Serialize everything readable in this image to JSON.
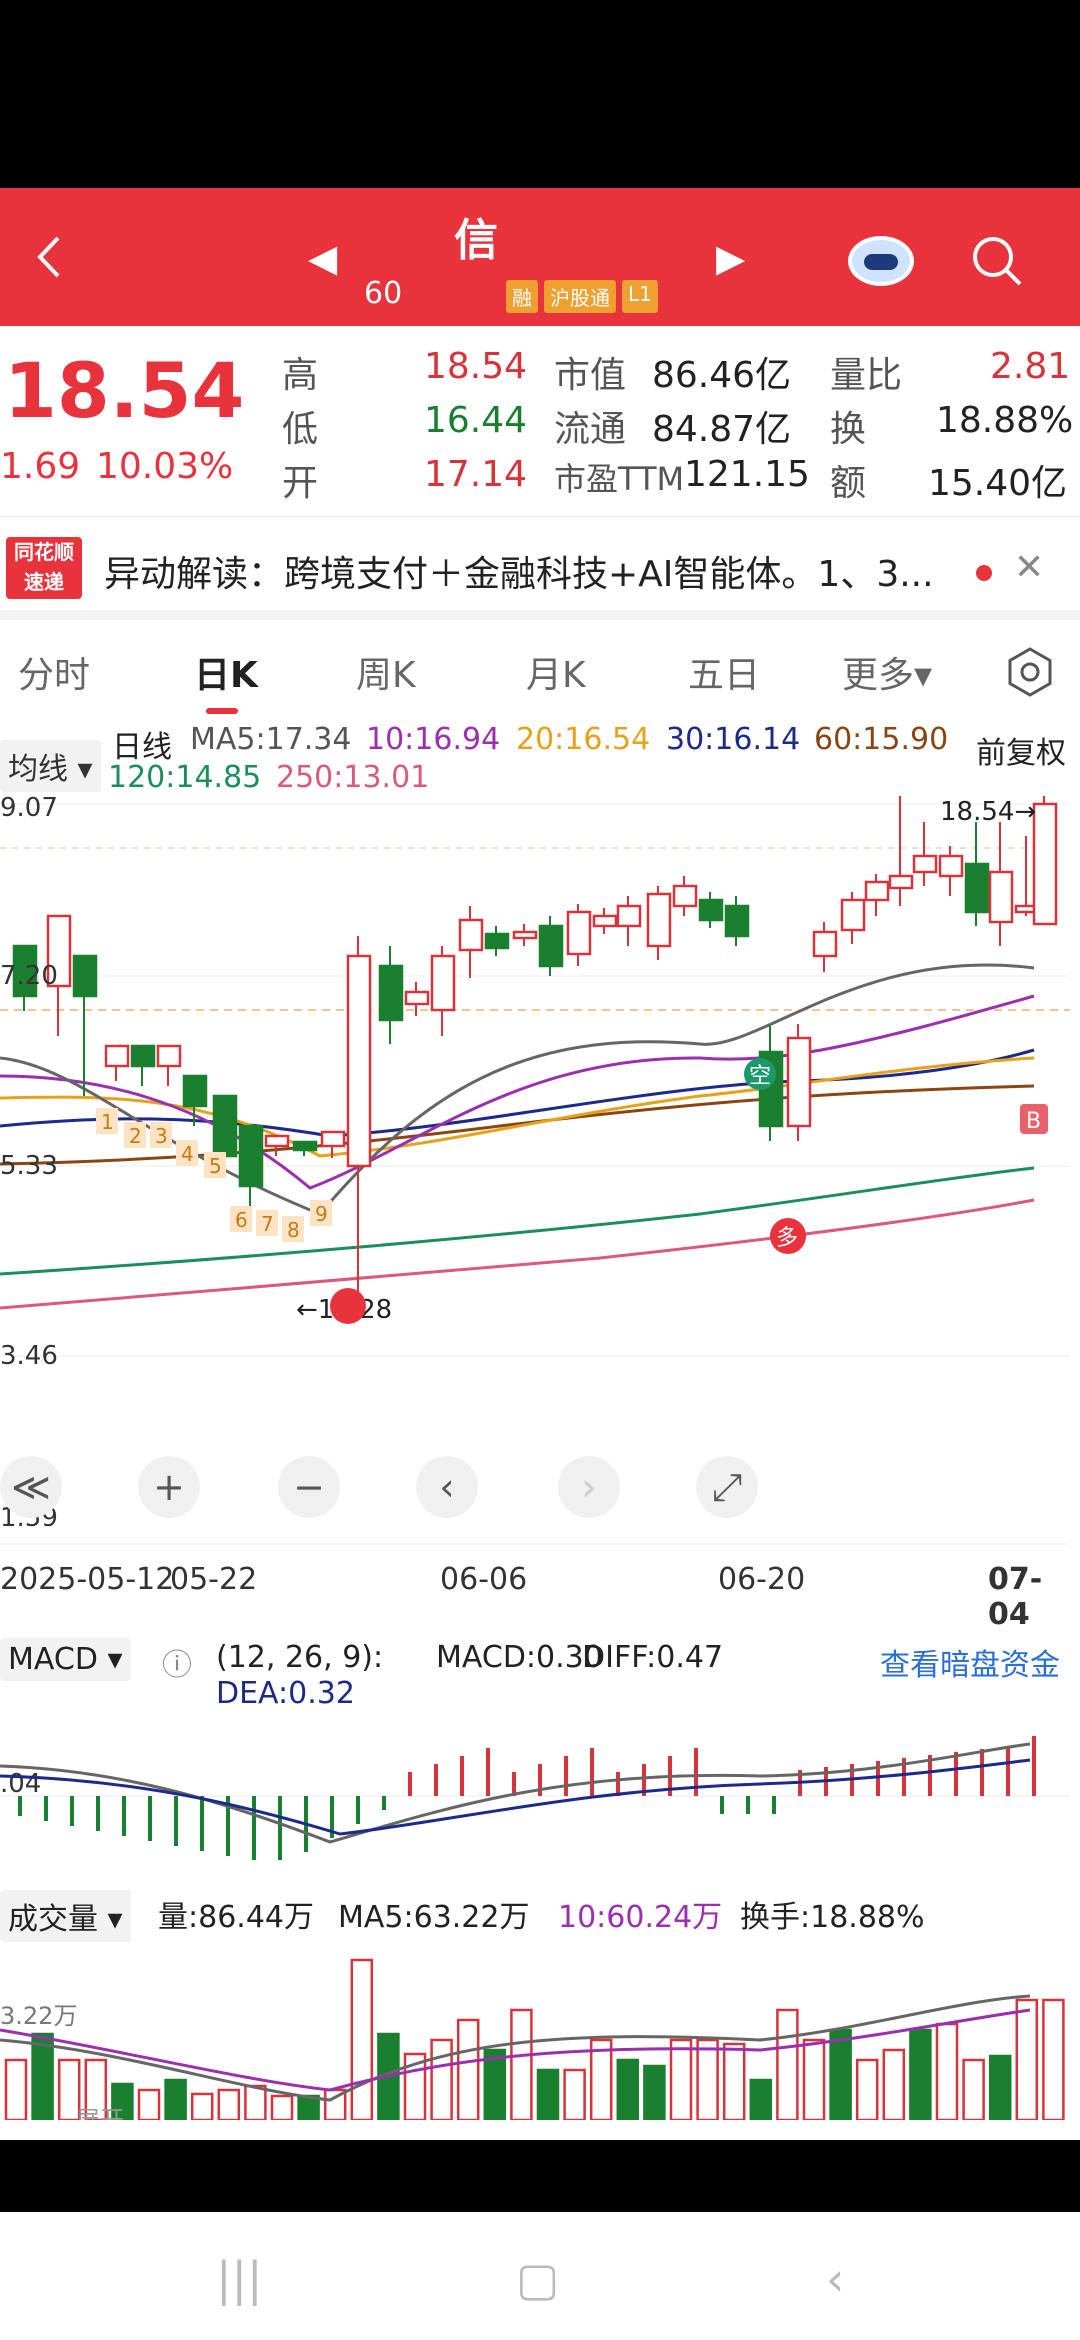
{
  "header": {
    "title": "信",
    "code": "60",
    "tags": [
      "融",
      "沪股通",
      "L1"
    ]
  },
  "quote": {
    "price": "18.54",
    "change": "1.69",
    "change_pct": "10.03%",
    "high_label": "高",
    "high": "18.54",
    "low_label": "低",
    "low": "16.44",
    "open_label": "开",
    "open": "17.14",
    "mktcap_label": "市值",
    "mktcap": "86.46亿",
    "float_label": "流通",
    "float": "84.87亿",
    "pe_label": "市盈TTM",
    "pe": "121.15",
    "vr_label": "量比",
    "vr": "2.81",
    "turnover_label": "换",
    "turnover": "18.88%",
    "amount_label": "额",
    "amount": "15.40亿"
  },
  "news": {
    "logo_line1": "同花顺",
    "logo_line2": "速递",
    "text": "异动解读：跨境支付＋金融科技+AI智能体。1、3..."
  },
  "tabs": [
    "分时",
    "日K",
    "周K",
    "月K",
    "五日",
    "更多▾"
  ],
  "ma": {
    "selector": "均线",
    "line_label": "日线",
    "ma5": "MA5:17.34",
    "ma10": "10:16.94",
    "ma20": "20:16.54",
    "ma30": "30:16.14",
    "ma60": "60:15.90",
    "ma120": "120:14.85",
    "ma250": "250:13.01",
    "adjust": "前复权"
  },
  "chart_data": {
    "type": "candlestick",
    "y_labels": [
      "9.07",
      "7.20",
      "5.33",
      "3.46",
      "1.59"
    ],
    "high_marker": "18.54→",
    "low_marker": "←14.28",
    "x_ticks": [
      "2025-05-12",
      "05-22",
      "06-06",
      "06-20",
      "07-04"
    ],
    "signals": [
      "空",
      "多",
      "B"
    ],
    "count_labels": [
      "1",
      "2",
      "3",
      "4",
      "5",
      "6",
      "7",
      "8",
      "9"
    ]
  },
  "controls": [
    "≪",
    "+",
    "−",
    "‹",
    "›",
    "⤢"
  ],
  "macd": {
    "selector": "MACD",
    "params": "(12, 26, 9):",
    "macd": "MACD:0.30",
    "diff": "DIFF:0.47",
    "dea": "DEA:0.32",
    "link": "查看暗盘资金",
    "axis_label": ".04"
  },
  "volume": {
    "selector": "成交量",
    "vol": "量:86.44万",
    "ma5": "MA5:63.22万",
    "ma10": "10:60.24万",
    "turnover": "换手:18.88%",
    "axis_label": "3.22万",
    "expand": "展开"
  },
  "colors": {
    "up": "#d8323a",
    "down": "#1a7f2e",
    "accent": "#e8333c"
  }
}
